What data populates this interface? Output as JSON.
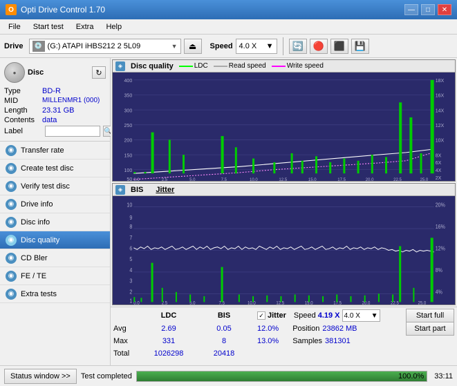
{
  "titlebar": {
    "icon": "O",
    "title": "Opti Drive Control 1.70",
    "minimize": "—",
    "maximize": "□",
    "close": "✕"
  },
  "menubar": {
    "items": [
      "File",
      "Start test",
      "Extra",
      "Help"
    ]
  },
  "toolbar": {
    "drive_label": "Drive",
    "drive_value": "(G:)  ATAPI iHBS212  2 5L09",
    "speed_label": "Speed",
    "speed_value": "4.0 X"
  },
  "disc": {
    "type_label": "Type",
    "type_value": "BD-R",
    "mid_label": "MID",
    "mid_value": "MILLENMR1 (000)",
    "length_label": "Length",
    "length_value": "23.31 GB",
    "contents_label": "Contents",
    "contents_value": "data",
    "label_label": "Label"
  },
  "nav_items": [
    {
      "id": "transfer-rate",
      "label": "Transfer rate"
    },
    {
      "id": "create-test-disc",
      "label": "Create test disc"
    },
    {
      "id": "verify-test-disc",
      "label": "Verify test disc"
    },
    {
      "id": "drive-info",
      "label": "Drive info"
    },
    {
      "id": "disc-info",
      "label": "Disc info"
    },
    {
      "id": "disc-quality",
      "label": "Disc quality",
      "active": true
    },
    {
      "id": "cd-bler",
      "label": "CD Bler"
    },
    {
      "id": "fe-te",
      "label": "FE / TE"
    },
    {
      "id": "extra-tests",
      "label": "Extra tests"
    }
  ],
  "chart_top": {
    "title": "Disc quality",
    "legend": [
      {
        "label": "LDC",
        "color": "#00ff00"
      },
      {
        "label": "Read speed",
        "color": "#ffffff"
      },
      {
        "label": "Write speed",
        "color": "#ff00ff"
      }
    ],
    "y_max": 400,
    "y_axis_right": [
      "18X",
      "16X",
      "14X",
      "12X",
      "10X",
      "8X",
      "6X",
      "4X",
      "2X"
    ],
    "x_axis": [
      "0.0",
      "2.5",
      "5.0",
      "7.5",
      "10.0",
      "12.5",
      "15.0",
      "17.5",
      "20.0",
      "22.5",
      "25.0"
    ]
  },
  "chart_bottom": {
    "title": "BIS",
    "title2": "Jitter",
    "y_max": 10,
    "y_axis_right": [
      "20%",
      "16%",
      "12%",
      "8%",
      "4%"
    ],
    "x_axis": [
      "0.0",
      "2.5",
      "5.0",
      "7.5",
      "10.0",
      "12.5",
      "15.0",
      "17.5",
      "20.0",
      "22.5",
      "25.0"
    ]
  },
  "stats": {
    "headers": [
      "LDC",
      "BIS"
    ],
    "rows": [
      {
        "label": "Avg",
        "ldc": "2.69",
        "bis": "0.05",
        "jitter_label": "Jitter",
        "jitter_value": "12.0%"
      },
      {
        "label": "Max",
        "ldc": "331",
        "bis": "8",
        "jitter_max": "13.0%"
      },
      {
        "label": "Total",
        "ldc": "1026298",
        "bis": "20418"
      }
    ],
    "speed_label": "Speed",
    "speed_value": "4.19 X",
    "speed_select": "4.0 X",
    "position_label": "Position",
    "position_value": "23862 MB",
    "samples_label": "Samples",
    "samples_value": "381301",
    "btn_start_full": "Start full",
    "btn_start_part": "Start part"
  },
  "statusbar": {
    "status_btn": "Status window >>",
    "status_text": "Test completed",
    "progress": 100,
    "progress_text": "100.0%",
    "time": "33:11"
  }
}
